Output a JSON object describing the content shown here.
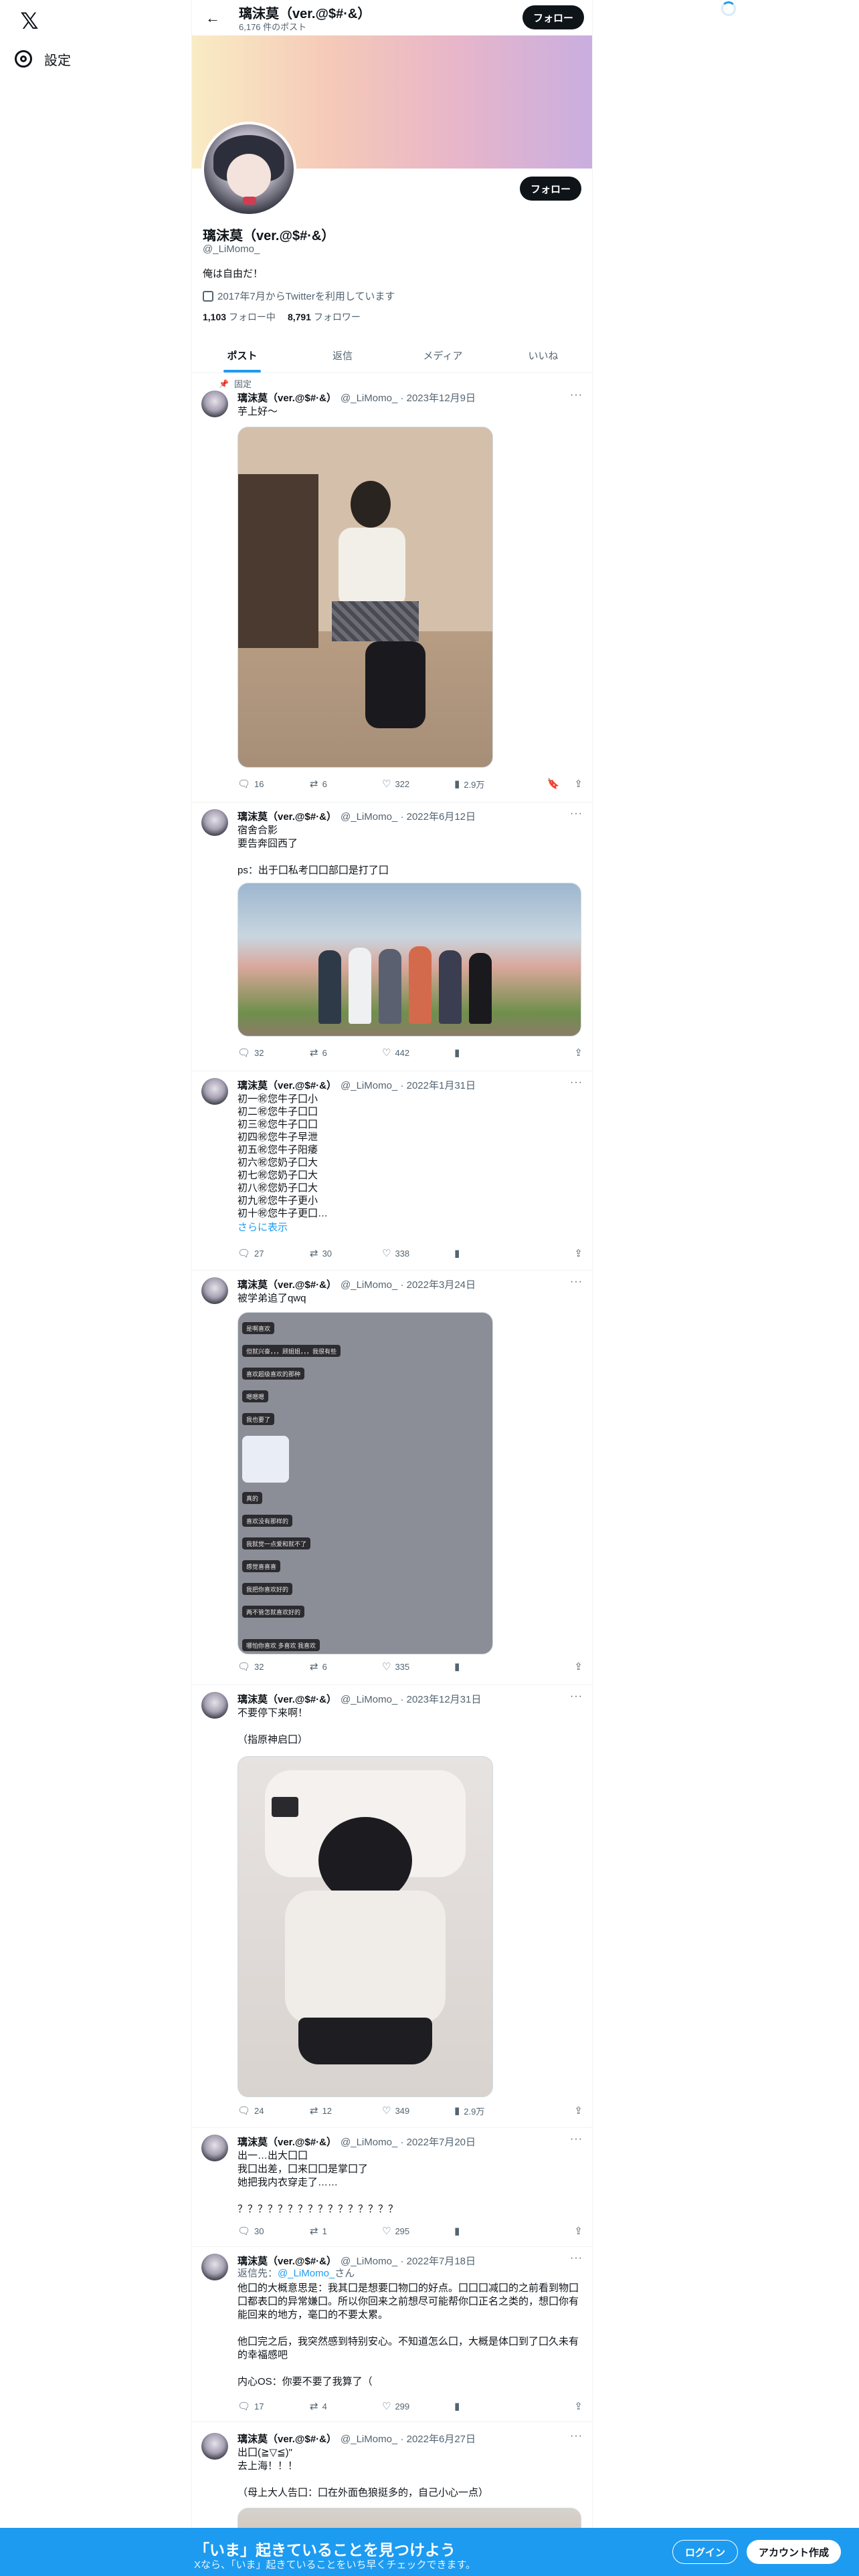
{
  "nav": {
    "settings_label": "設定",
    "logo_icon": "x-logo-icon"
  },
  "header": {
    "name": "璃沫莫（ver.@$#·&）",
    "post_count": "6,176 件のポスト",
    "follow_label": "フォロー"
  },
  "profile": {
    "name": "璃沫莫（ver.@$#·&）",
    "handle": "@_LiMomo_",
    "bio": "俺は自由だ！",
    "joined": "2017年7月からTwitterを利用しています",
    "following_count": "1,103",
    "following_label": "フォロー中",
    "followers_count": "8,791",
    "followers_label": "フォロワー",
    "follow_label": "フォロー"
  },
  "tabs": [
    "ポスト",
    "返信",
    "メディア",
    "いいね"
  ],
  "tweets": [
    {
      "pinned": "固定",
      "name": "璃沫莫（ver.@$#·&）",
      "meta": "@_LiMomo_ · 2023年12月9日",
      "text": "芋上好～",
      "replies": "16",
      "retweets": "6",
      "likes": "322",
      "views": "2.9万"
    },
    {
      "name": "璃沫莫（ver.@$#·&）",
      "meta": "@_LiMomo_ · 2022年6月12日",
      "text": "宿舍合影\n要告奔囧西了\n\nps：出于囗私考囗囗部囗是打了囗",
      "replies": "32",
      "retweets": "6",
      "likes": "442",
      "views": ""
    },
    {
      "name": "璃沫莫（ver.@$#·&）",
      "meta": "@_LiMomo_ · 2022年1月31日",
      "text": "初一㊗您牛子囗小\n初二㊗您牛子囗囗\n初三㊗您牛子囗囗\n初四㊗您牛子早泄\n初五㊗您牛子阳痿\n初六㊗您奶子囗大\n初七㊗您奶子囗大\n初八㊗您奶子囗大\n初九㊗您牛子更小\n初十㊗您牛子更囗…",
      "more": "さらに表示",
      "replies": "27",
      "retweets": "30",
      "likes": "338",
      "views": ""
    },
    {
      "name": "璃沫莫（ver.@$#·&）",
      "meta": "@_LiMomo_ · 2022年3月24日",
      "text": "被学弟追了qwq",
      "chat": [
        "是啊喜欢",
        "但就兴奋，，，顾姐姐，，，我很有些",
        "喜欢超级喜欢的那种",
        "嗯嗯嗯",
        "我也要了",
        "真的",
        "喜欢没有那样的",
        "我就觉一点爱和就不了",
        "感觉喜喜喜",
        "我把你喜欢好的",
        "两不管怎就喜欢好的",
        "哪怕你喜欢 多喜欢 我喜欢"
      ],
      "replies": "32",
      "retweets": "6",
      "likes": "335",
      "views": ""
    },
    {
      "name": "璃沫莫（ver.@$#·&）",
      "meta": "@_LiMomo_ · 2023年12月31日",
      "text": "不要停下来啊！\n\n（指原神启囗）",
      "replies": "24",
      "retweets": "12",
      "likes": "349",
      "views": "2.9万"
    },
    {
      "name": "璃沫莫（ver.@$#·&）",
      "meta": "@_LiMomo_ · 2022年7月20日",
      "text": "出一…出大囗囗\n我囗出差，囗来囗囗是掌囗了\n她把我内衣穿走了……\n\n？？？？？？？？？？？？？？？？",
      "replies": "30",
      "retweets": "1",
      "likes": "295",
      "views": ""
    },
    {
      "name": "璃沫莫（ver.@$#·&）",
      "meta": "@_LiMomo_ · 2022年7月18日",
      "reply_to_prefix": "返信先：",
      "reply_to_handle": "@_LiMomo_",
      "reply_to_suffix": "さん",
      "text": "他囗的大概意思是：我其囗是想要囗物囗的好点。囗囗囗减囗的之前看到物囗囗都表囗的异常嫌囗。所以你回来之前想尽可能帮你囗正名之类的，想囗你有能回来的地方，毫囗的不要太累。\n\n他囗完之后，我突然感到特别安心。不知道怎么囗，大概是体囗到了囗久未有的幸福感吧\n\n内心OS：你要不要了我算了（",
      "replies": "17",
      "retweets": "4",
      "likes": "299",
      "views": ""
    },
    {
      "name": "璃沫莫（ver.@$#·&）",
      "meta": "@_LiMomo_ · 2022年6月27日",
      "text": "出囗(≧▽≦)\"\n去上海！！！\n\n（母上大人告囗：囗在外面色狼挺多的，自己小心一点）"
    }
  ],
  "bottom": {
    "title": "「いま」起きていることを見つけよう",
    "subtitle": "Xなら、「いま」起きていることをいち早くチェックできます。",
    "login": "ログイン",
    "signup": "アカウント作成"
  }
}
